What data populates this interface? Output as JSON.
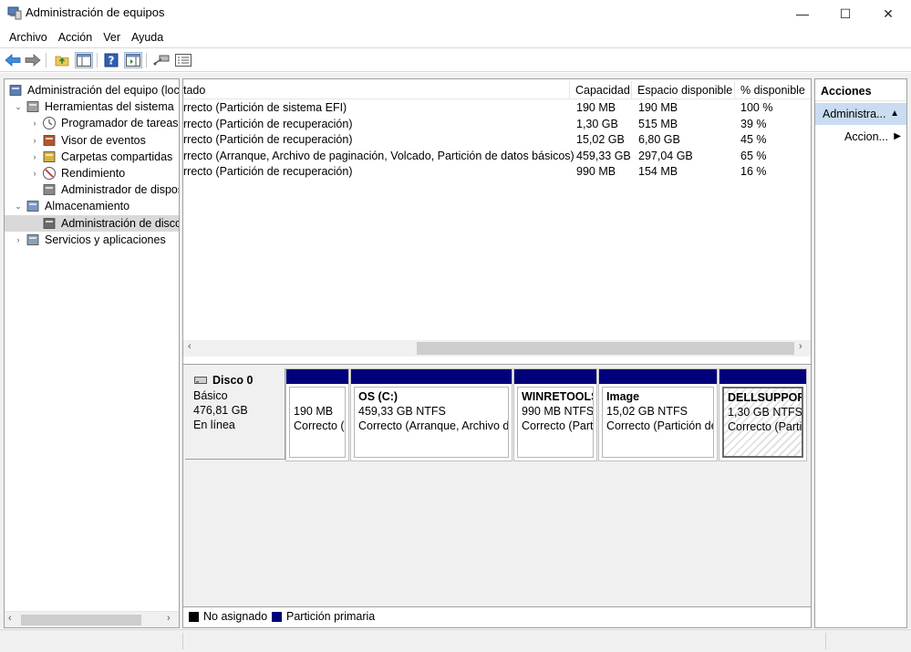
{
  "window": {
    "title": "Administración de equipos",
    "controls": {
      "minimize": "—",
      "maximize": "☐",
      "close": "✕"
    }
  },
  "menu": [
    "Archivo",
    "Acción",
    "Ver",
    "Ayuda"
  ],
  "toolbar": {
    "icons": [
      "back-arrow-icon",
      "forward-arrow-icon",
      "up-folder-icon",
      "console-tree-icon",
      "help-icon",
      "show-pane-icon",
      "connect-icon",
      "properties-icon"
    ]
  },
  "tree": {
    "items": [
      {
        "label": "Administración del equipo (loca",
        "level": 0,
        "expander": "",
        "icon": "computer-icon"
      },
      {
        "label": "Herramientas del sistema",
        "level": 1,
        "expander": "⌄",
        "icon": "tools-icon"
      },
      {
        "label": "Programador de tareas",
        "level": 2,
        "expander": "›",
        "icon": "clock-icon"
      },
      {
        "label": "Visor de eventos",
        "level": 2,
        "expander": "›",
        "icon": "event-viewer-icon"
      },
      {
        "label": "Carpetas compartidas",
        "level": 2,
        "expander": "›",
        "icon": "shared-folder-icon"
      },
      {
        "label": "Rendimiento",
        "level": 2,
        "expander": "›",
        "icon": "performance-icon"
      },
      {
        "label": "Administrador de dispos",
        "level": 2,
        "expander": "",
        "icon": "device-manager-icon"
      },
      {
        "label": "Almacenamiento",
        "level": 1,
        "expander": "⌄",
        "icon": "storage-icon"
      },
      {
        "label": "Administración de disco",
        "level": 2,
        "expander": "",
        "icon": "disk-management-icon"
      },
      {
        "label": "Servicios y aplicaciones",
        "level": 1,
        "expander": "›",
        "icon": "services-icon"
      }
    ]
  },
  "volumes": {
    "columns": [
      "tado",
      "Capacidad",
      "Espacio disponible",
      "% disponible"
    ],
    "rows": [
      [
        "rrecto (Partición de sistema EFI)",
        "190 MB",
        "190 MB",
        "100 %"
      ],
      [
        "rrecto (Partición de recuperación)",
        "1,30 GB",
        "515 MB",
        "39 %"
      ],
      [
        "rrecto (Partición de recuperación)",
        "15,02 GB",
        "6,80 GB",
        "45 %"
      ],
      [
        "rrecto (Arranque, Archivo de paginación, Volcado, Partición de datos básicos)",
        "459,33 GB",
        "297,04 GB",
        "65 %"
      ],
      [
        "rrecto (Partición de recuperación)",
        "990 MB",
        "154 MB",
        "16 %"
      ]
    ]
  },
  "disk": {
    "name": "Disco 0",
    "type": "Básico",
    "size": "476,81 GB",
    "state": "En línea",
    "partitions": [
      {
        "name": "",
        "size": "190 MB",
        "status": "Correcto (I"
      },
      {
        "name": "OS  (C:)",
        "size": "459,33 GB NTFS",
        "status": "Correcto (Arranque, Archivo de"
      },
      {
        "name": "WINRETOOLS",
        "size": "990 MB NTFS",
        "status": "Correcto (Parti"
      },
      {
        "name": "Image",
        "size": "15,02 GB NTFS",
        "status": "Correcto (Partición de"
      },
      {
        "name": "DELLSUPPORT",
        "size": "1,30 GB NTFS",
        "status": "Correcto (Partic"
      }
    ]
  },
  "legend": [
    {
      "label": "No asignado",
      "color": "#000000"
    },
    {
      "label": "Partición primaria",
      "color": "#00007a"
    }
  ],
  "actions": {
    "title": "Acciones",
    "section": "Administra...",
    "item": "Accion..."
  }
}
